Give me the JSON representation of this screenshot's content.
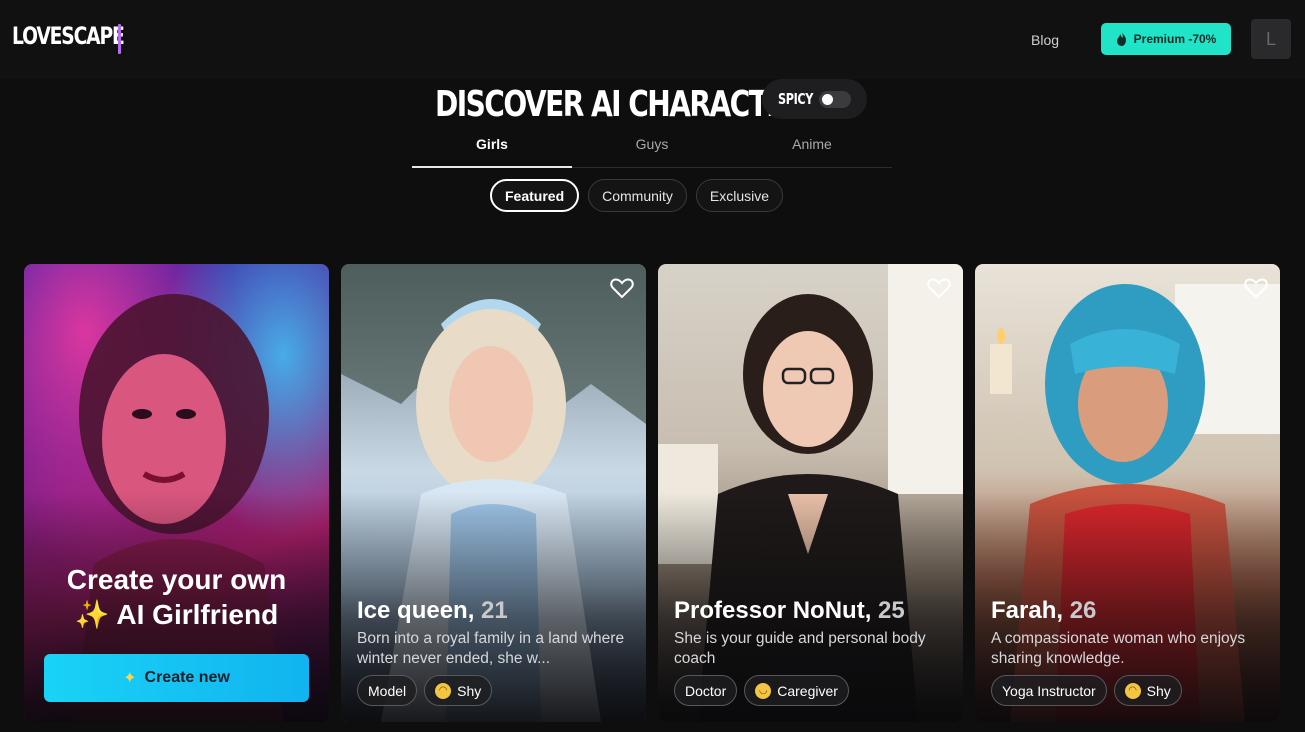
{
  "header": {
    "logo": "LOVESCAPE",
    "blog_label": "Blog",
    "premium_label": "Premium -70%",
    "avatar_initial": "L"
  },
  "discover": {
    "title": "DISCOVER AI CHARACTERS",
    "spicy_label": "SPICY",
    "spicy_on": false,
    "tabs": [
      {
        "label": "Girls",
        "active": true
      },
      {
        "label": "Guys",
        "active": false
      },
      {
        "label": "Anime",
        "active": false
      }
    ],
    "filters": [
      {
        "label": "Featured",
        "active": true
      },
      {
        "label": "Community",
        "active": false
      },
      {
        "label": "Exclusive",
        "active": false
      }
    ]
  },
  "create_card": {
    "line1": "Create your own",
    "line2": "✨ AI Girlfriend",
    "button_label": "Create new"
  },
  "characters": [
    {
      "name": "Ice queen,",
      "age": "21",
      "description": "Born into a royal family in a land where winter never ended, she w...",
      "tags": [
        {
          "label": "Model",
          "emoji": ""
        },
        {
          "label": "Shy",
          "emoji": "😇"
        }
      ]
    },
    {
      "name": "Professor NoNut,",
      "age": "25",
      "description": "She is your guide and personal body coach",
      "tags": [
        {
          "label": "Doctor",
          "emoji": ""
        },
        {
          "label": "Caregiver",
          "emoji": "🙂"
        }
      ]
    },
    {
      "name": "Farah,",
      "age": "26",
      "description": "A compassionate woman who enjoys sharing knowledge.",
      "tags": [
        {
          "label": "Yoga Instructor",
          "emoji": ""
        },
        {
          "label": "Shy",
          "emoji": "😇"
        }
      ]
    }
  ],
  "colors": {
    "background": "#0e0e0f",
    "premium_accent": "#21e3c7",
    "create_button": "#19d3f5",
    "logo_bar": "#b56cf0"
  }
}
